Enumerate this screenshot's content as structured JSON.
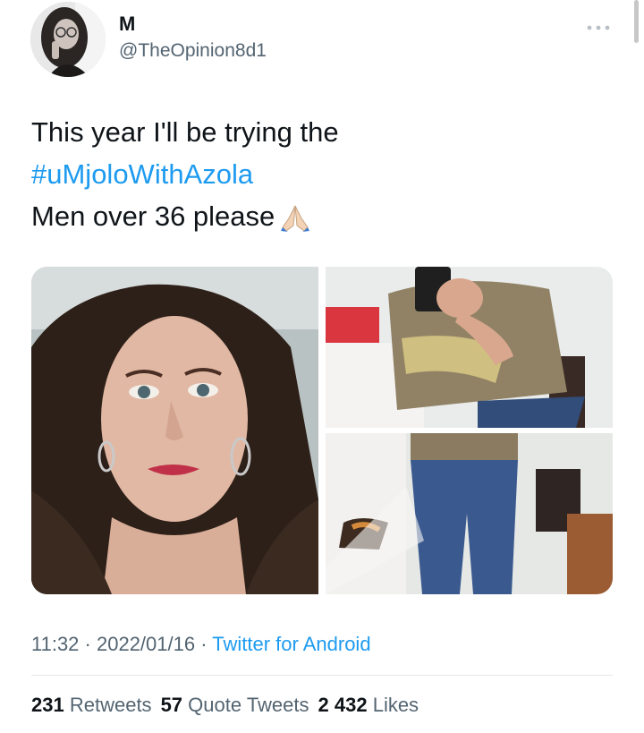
{
  "tweet": {
    "author": {
      "display_name": "M",
      "handle": "@TheOpinion8d1",
      "avatar_icon": "profile-photo"
    },
    "more_icon": "more-dots-icon",
    "text": {
      "line1": "This year I'll be trying the",
      "hashtag": "#uMjoloWithAzola",
      "line3": "Men over 36 please",
      "emoji": "🙏"
    },
    "media": [
      {
        "name": "photo-selfie-face",
        "description": ""
      },
      {
        "name": "photo-mirror-shirt",
        "description": ""
      },
      {
        "name": "photo-mirror-jeans",
        "description": ""
      }
    ],
    "meta": {
      "time": "11:32",
      "sep1": " · ",
      "date": "2022/01/16",
      "sep2": " · ",
      "source": "Twitter for Android"
    },
    "stats": {
      "retweets_count": "231",
      "retweets_label": "Retweets",
      "quotes_count": "57",
      "quotes_label": "Quote Tweets",
      "likes_count": "2 432",
      "likes_label": "Likes"
    }
  },
  "colors": {
    "link": "#1d9bf0",
    "text": "#0f1419",
    "secondary": "#536471"
  }
}
